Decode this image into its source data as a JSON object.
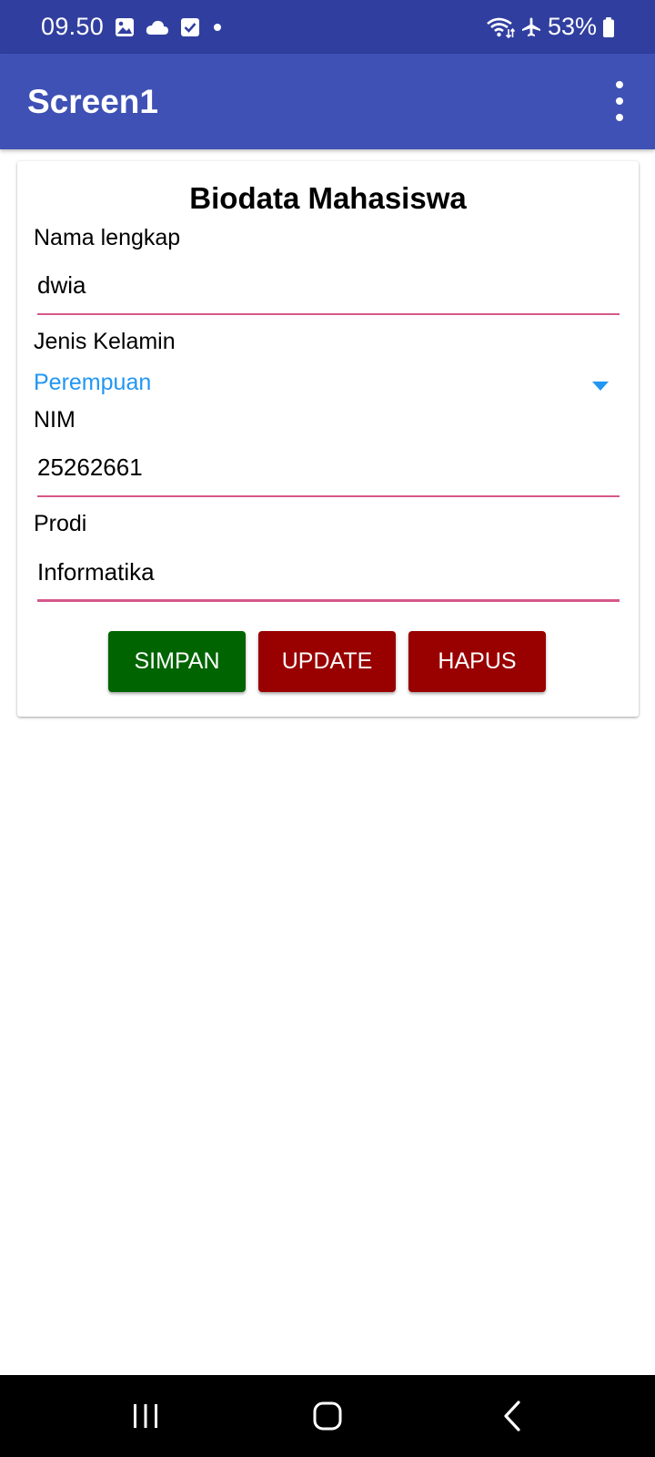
{
  "status_bar": {
    "time": "09.50",
    "battery_text": "53%",
    "icons_left": [
      "gallery-icon",
      "cloud-icon",
      "checkbox-icon",
      "dot-icon"
    ],
    "icons_right": [
      "wifi-icon",
      "airplane-icon",
      "battery-icon"
    ]
  },
  "app_bar": {
    "title": "Screen1",
    "menu_icon": "more-vert-icon"
  },
  "form": {
    "title": "Biodata Mahasiswa",
    "nama": {
      "label": "Nama lengkap",
      "value": "dwia"
    },
    "jenis_kelamin": {
      "label": "Jenis Kelamin",
      "selected": "Perempuan"
    },
    "nim": {
      "label": "NIM",
      "value": "25262661"
    },
    "prodi": {
      "label": "Prodi",
      "value": "Informatika"
    },
    "buttons": {
      "simpan": "SIMPAN",
      "update": "UPDATE",
      "hapus": "HAPUS"
    }
  },
  "colors": {
    "status_bar": "#303F9F",
    "app_bar": "#3F51B5",
    "underline": "#D6588A",
    "spinner_text": "#2196F3",
    "simpan_button": "#006400",
    "update_hapus_button": "#990000"
  },
  "nav_bar": {
    "recents_icon": "recents-icon",
    "home_icon": "home-icon",
    "back_icon": "back-icon"
  }
}
